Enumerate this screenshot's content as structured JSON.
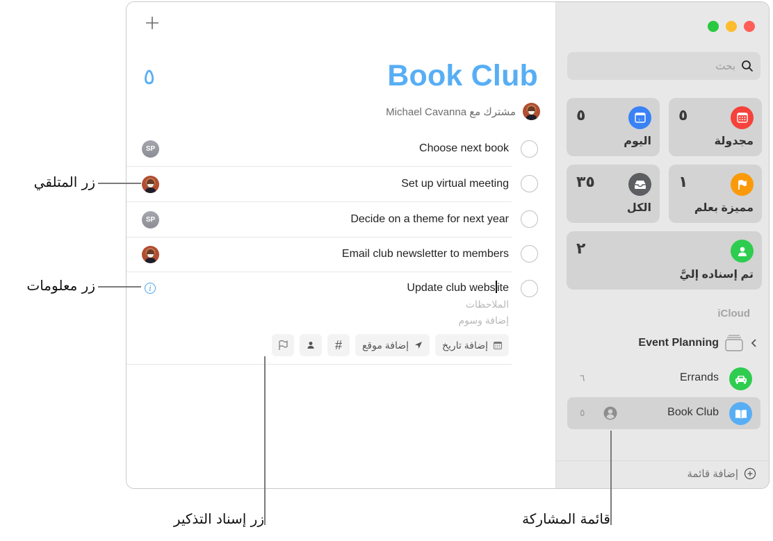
{
  "window": {
    "traffic_lights": {
      "close": "#ff5f57",
      "minimize": "#febc2e",
      "zoom": "#28c840"
    }
  },
  "main": {
    "add_icon": "plus-icon",
    "list_title": "Book Club",
    "list_count": "٥",
    "accent_color": "#57aef5",
    "shared_with_label": "مشترك مع Michael Cavanna",
    "tasks": [
      {
        "title": "Choose next book",
        "assignee": "SP"
      },
      {
        "title": "Set up virtual meeting",
        "assignee": "avatar"
      },
      {
        "title": "Decide on a theme for next year",
        "assignee": "SP"
      },
      {
        "title": "Email club newsletter to members",
        "assignee": "avatar"
      }
    ],
    "editing_task": {
      "title_before_caret": "Update club webs",
      "title_after_caret": "ite",
      "notes_placeholder": "الملاحظات",
      "tags_placeholder": "إضافة وسوم",
      "add_date_label": "إضافة تاريخ",
      "add_location_label": "إضافة موقع",
      "tag_symbol": "#"
    }
  },
  "sidebar": {
    "search_placeholder": "بحث",
    "smart_lists": [
      {
        "label": "مجدولة",
        "count": "٥",
        "color": "#f5423a",
        "icon": "calendar-icon"
      },
      {
        "label": "اليوم",
        "count": "٥",
        "color": "#3a82f6",
        "icon": "today-icon"
      },
      {
        "label": "مميزة بعلم",
        "count": "١",
        "color": "#fb9a09",
        "icon": "flag-icon"
      },
      {
        "label": "الكل",
        "count": "٣٥",
        "color": "#5c5e62",
        "icon": "tray-icon"
      },
      {
        "label": "تم إسناده إليَّ",
        "count": "٢",
        "color": "#2ecc4f",
        "icon": "person-icon"
      }
    ],
    "section_label": "iCloud",
    "group": {
      "label": "Event Planning"
    },
    "lists": [
      {
        "label": "Errands",
        "count": "٦",
        "color": "#2ecc4f",
        "icon": "car-icon",
        "selected": false
      },
      {
        "label": "Book Club",
        "count": "٥",
        "color": "#57aef5",
        "icon": "book-icon",
        "selected": true,
        "shared": true
      }
    ],
    "add_list_label": "إضافة قائمة"
  },
  "callouts": {
    "assignee_button": "زر المتلقي",
    "info_button": "زر معلومات",
    "assign_reminder_button": "زر إسناد التذكير",
    "shared_list": "قائمة المشاركة"
  }
}
